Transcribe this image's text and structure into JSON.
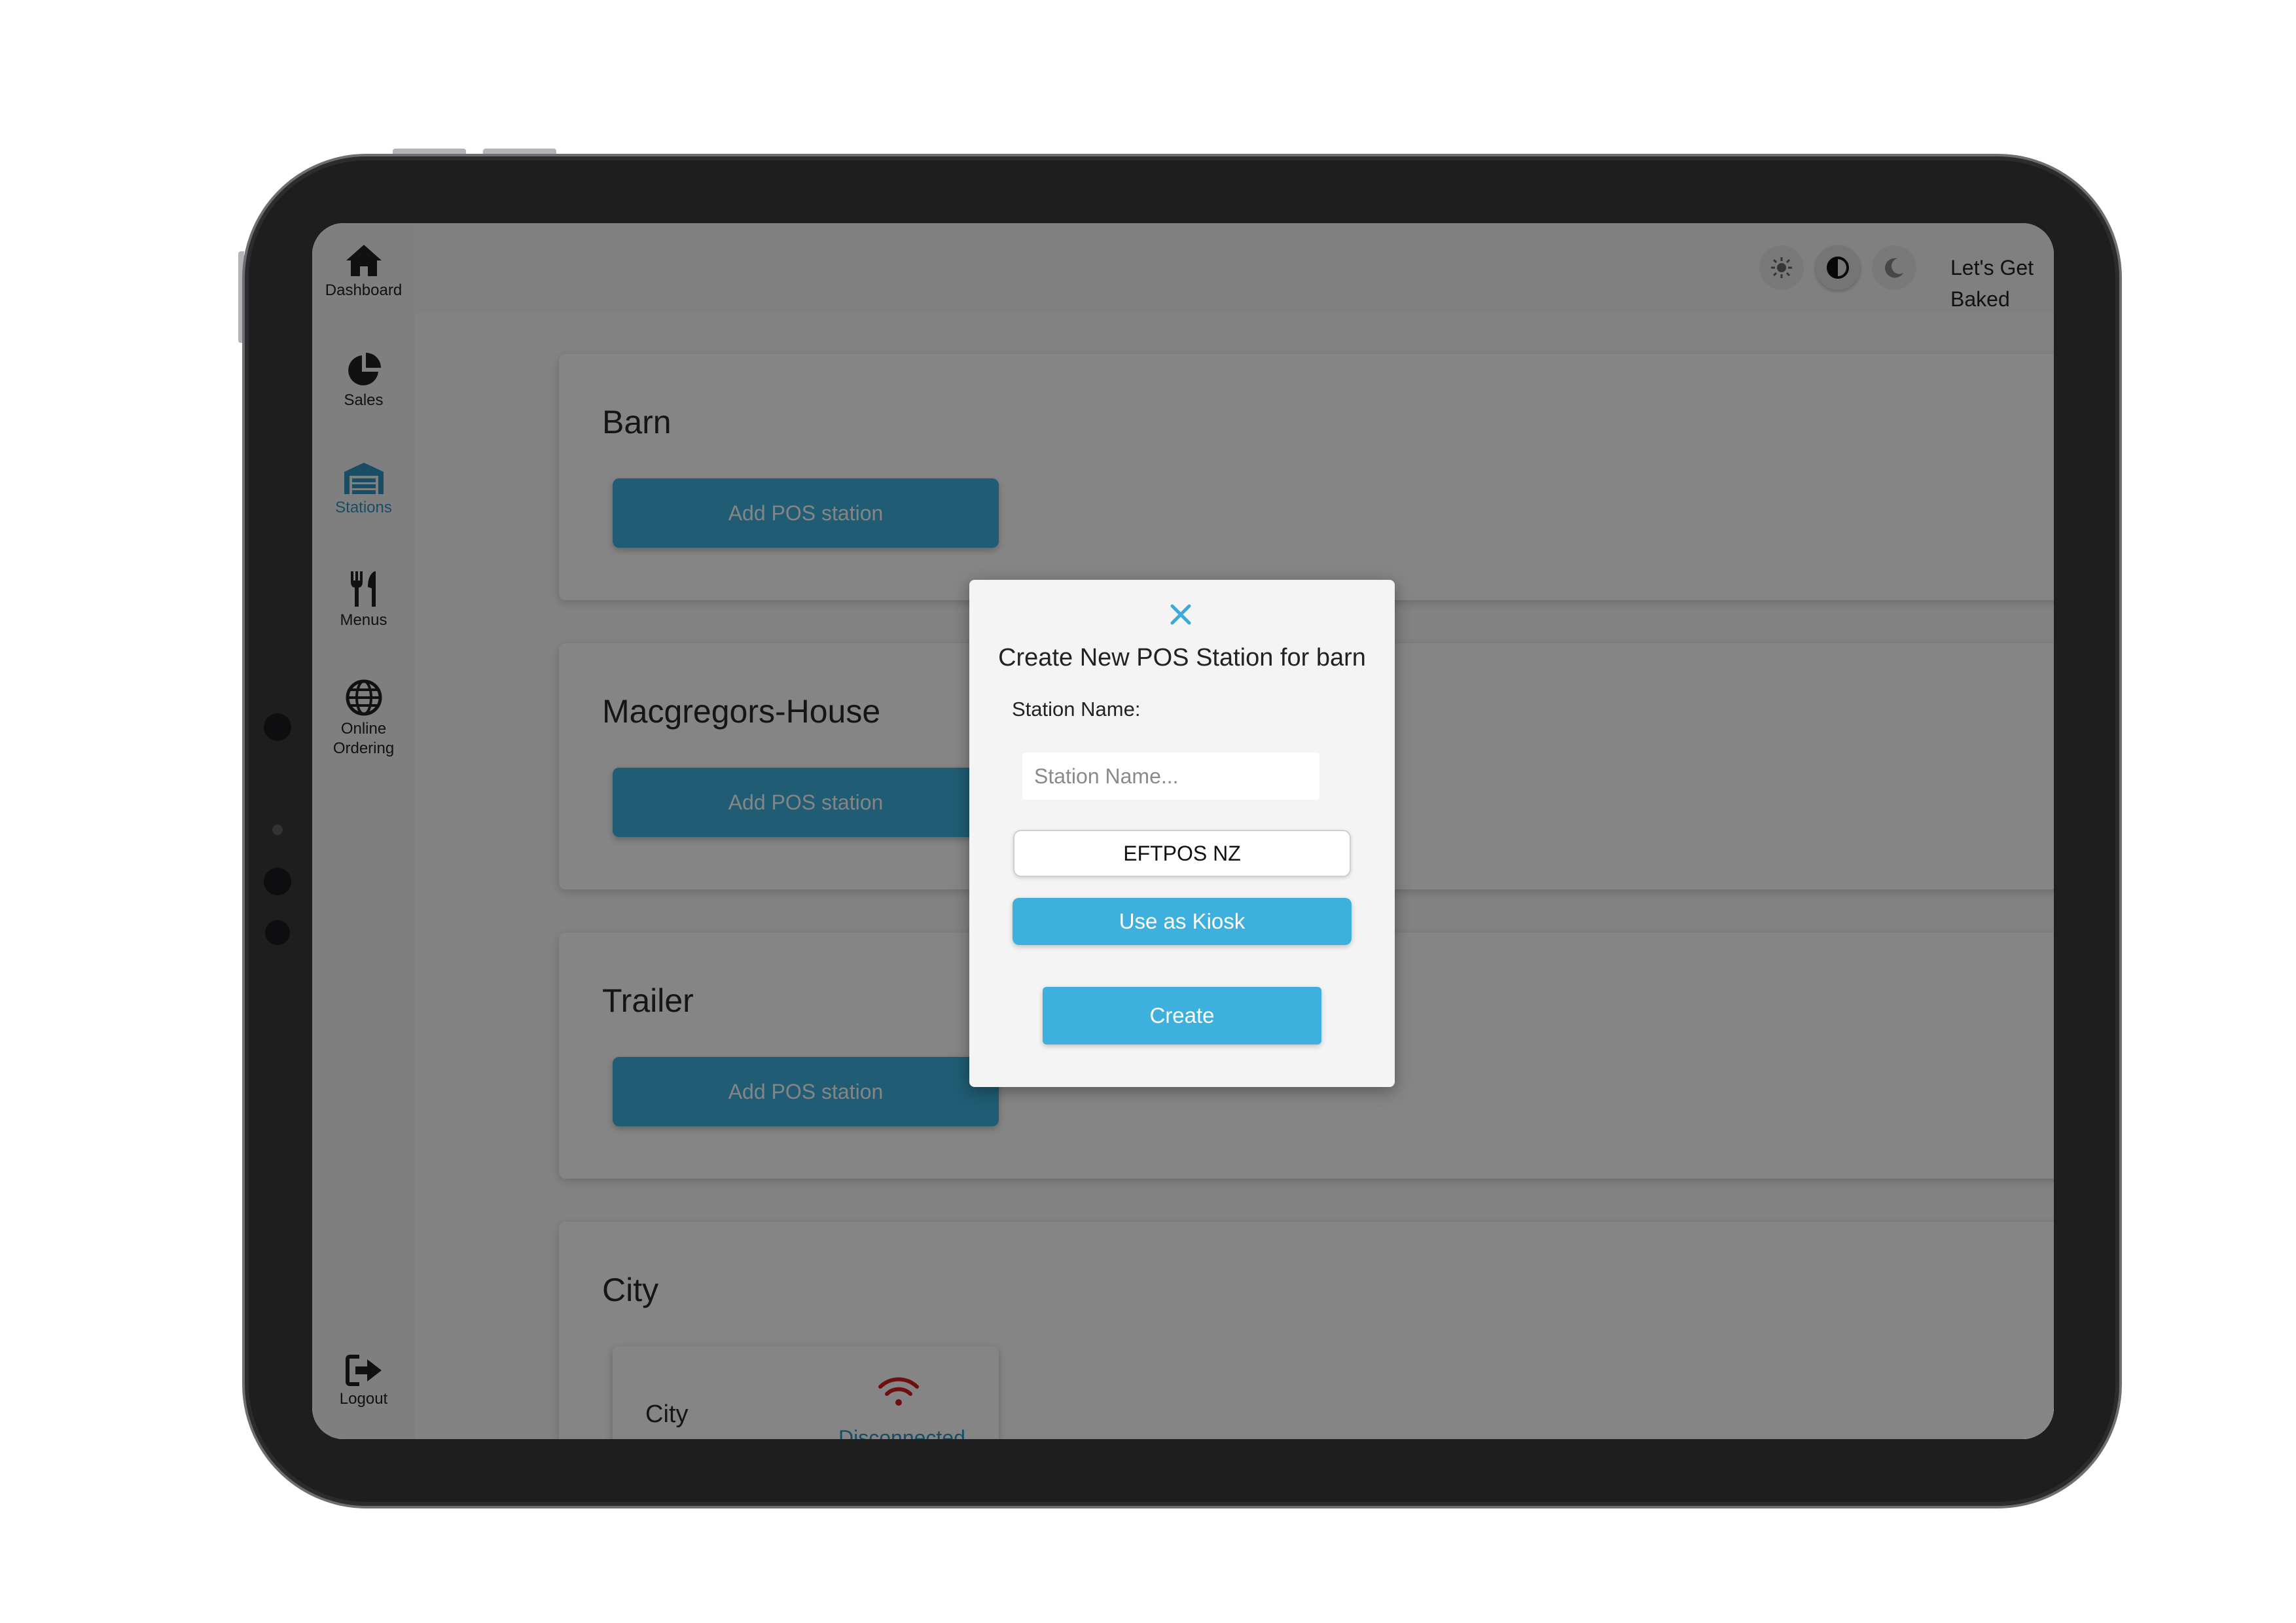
{
  "nav": {
    "dashboard": "Dashboard",
    "sales": "Sales",
    "stations": "Stations",
    "menus": "Menus",
    "online_ordering_line1": "Online",
    "online_ordering_line2": "Ordering",
    "logout": "Logout"
  },
  "topbar": {
    "brand": "Let's Get Baked",
    "theme_options": [
      "sun-icon",
      "contrast-icon",
      "moon-icon"
    ],
    "selected_theme": "contrast-icon"
  },
  "locations": [
    {
      "name": "Barn",
      "action": "Add POS station"
    },
    {
      "name": "Macgregors-House",
      "action": "Add POS station"
    },
    {
      "name": "Trailer",
      "action": "Add POS station"
    },
    {
      "name": "City",
      "station": {
        "name": "City",
        "status": "Disconnected"
      }
    }
  ],
  "modal": {
    "title": "Create New POS Station for barn",
    "field_label": "Station Name:",
    "name_placeholder": "Station Name...",
    "name_value": "",
    "payment_provider": "EFTPOS NZ",
    "kiosk_label": "Use as Kiosk",
    "create_label": "Create"
  },
  "colors": {
    "accent": "#3eb0dd",
    "active_nav": "#2f94be",
    "status_error": "#d32020"
  }
}
